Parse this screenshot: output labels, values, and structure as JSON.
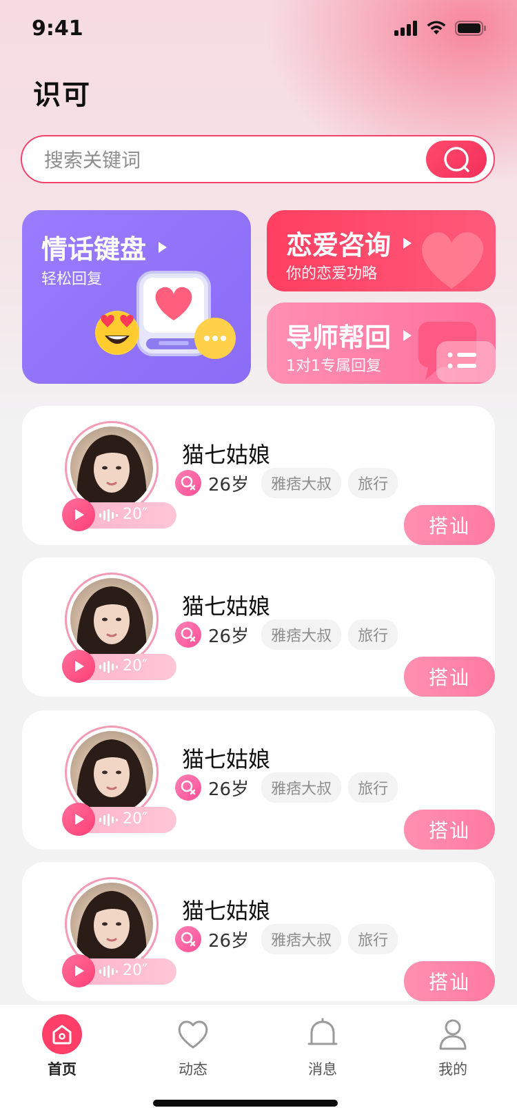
{
  "status_bar": {
    "time": "9:41"
  },
  "app": {
    "title": "识可"
  },
  "search": {
    "placeholder": "搜索关键词"
  },
  "feature_cards": [
    {
      "title": "情话键盘",
      "subtitle": "轻松回复"
    },
    {
      "title": "恋爱咨询",
      "subtitle": "你的恋爱功略"
    },
    {
      "title": "导师帮回",
      "subtitle": "1对1专属回复"
    }
  ],
  "profiles": [
    {
      "name": "猫七姑娘",
      "age": "26岁",
      "tags": [
        "雅痞大叔",
        "旅行"
      ],
      "voice_duration": "20″",
      "action": "搭讪"
    },
    {
      "name": "猫七姑娘",
      "age": "26岁",
      "tags": [
        "雅痞大叔",
        "旅行"
      ],
      "voice_duration": "20″",
      "action": "搭讪"
    },
    {
      "name": "猫七姑娘",
      "age": "26岁",
      "tags": [
        "雅痞大叔",
        "旅行"
      ],
      "voice_duration": "20″",
      "action": "搭讪"
    },
    {
      "name": "猫七姑娘",
      "age": "26岁",
      "tags": [
        "雅痞大叔",
        "旅行"
      ],
      "voice_duration": "20″",
      "action": "搭讪"
    }
  ],
  "tabbar": [
    {
      "label": "首页",
      "icon": "home-icon",
      "active": true
    },
    {
      "label": "动态",
      "icon": "heart-icon",
      "active": false
    },
    {
      "label": "消息",
      "icon": "bell-icon",
      "active": false
    },
    {
      "label": "我的",
      "icon": "user-icon",
      "active": false
    }
  ],
  "colors": {
    "accent": "#f2426a",
    "keyboard_card": "#8f72fb",
    "love_card": "#ff4466",
    "mentor_card": "#ff7ea5",
    "hit_button": "#ff86aa"
  }
}
